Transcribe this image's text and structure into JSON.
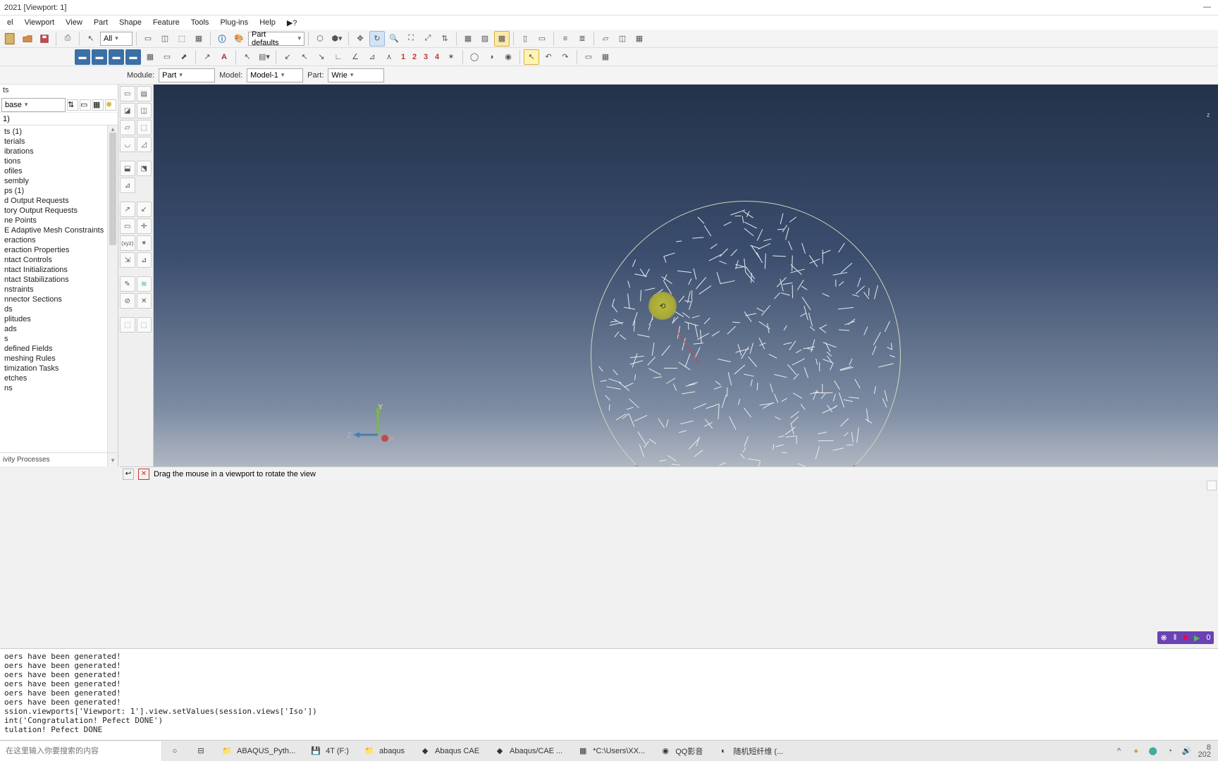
{
  "window": {
    "title": "2021  [Viewport: 1]",
    "min": "—",
    "restore": "",
    "close": ""
  },
  "menu": [
    "el",
    "Viewport",
    "View",
    "Part",
    "Shape",
    "Feature",
    "Tools",
    "Plug-ins",
    "Help",
    "▶?"
  ],
  "toolbar1": {
    "visibility_combo": "All",
    "part_defaults": "Part defaults"
  },
  "numbers": [
    "1",
    "2",
    "3",
    "4"
  ],
  "context": {
    "module_label": "Module:",
    "module_value": "Part",
    "model_label": "Model:",
    "model_value": "Model-1",
    "part_label": "Part:",
    "part_value": "Wrie"
  },
  "leftpanel": {
    "tab": "ts",
    "filter": "base",
    "root": "1)",
    "items": [
      "ts (1)",
      "terials",
      "ibrations",
      "tions",
      "ofiles",
      "sembly",
      "ps (1)",
      "d Output Requests",
      "tory Output Requests",
      "ne Points",
      "E Adaptive Mesh Constraints",
      "eractions",
      "eraction Properties",
      "ntact Controls",
      "ntact Initializations",
      "ntact Stabilizations",
      "nstraints",
      "nnector Sections",
      "ds",
      "plitudes",
      "ads",
      "s",
      "defined Fields",
      "meshing Rules",
      "timization Tasks",
      "etches",
      "ns"
    ],
    "footer": "ivity Processes"
  },
  "viewport": {
    "triad_y": "Y",
    "triad_z": "Z",
    "triad_x": "X",
    "cube_z": "z",
    "rotate_glyph": "⟲"
  },
  "prompt": {
    "back": "↩",
    "cancel": "✕",
    "text": "Drag the mouse in a viewport to rotate the view"
  },
  "messages": "oers have been generated!\noers have been generated!\noers have been generated!\noers have been generated!\noers have been generated!\noers have been generated!\nssion.viewports['Viewport: 1'].view.setValues(session.views['Iso'])\nint('Congratulation! Pefect DONE')\ntulation! Pefect DONE",
  "recorder": {
    "a": "❋",
    "b": "‖",
    "c": "■",
    "d": "▶",
    "e": "0"
  },
  "taskbar": {
    "search_placeholder": "在这里输入你要搜索的内容",
    "items": [
      {
        "icon": "○",
        "label": ""
      },
      {
        "icon": "⊟",
        "label": ""
      },
      {
        "icon": "📁",
        "label": "ABAQUS_Pyth..."
      },
      {
        "icon": "💾",
        "label": "4T (F:)"
      },
      {
        "icon": "📁",
        "label": "abaqus"
      },
      {
        "icon": "◆",
        "label": "Abaqus CAE"
      },
      {
        "icon": "◆",
        "label": "Abaqus/CAE ..."
      },
      {
        "icon": "▦",
        "label": "*C:\\Users\\XX..."
      },
      {
        "icon": "◉",
        "label": "QQ影音"
      },
      {
        "icon": "◐",
        "label": "随机短纤维 (..."
      }
    ],
    "tray": [
      "^",
      "●",
      "⬤",
      "◔",
      "🔊",
      "8",
      "202"
    ]
  },
  "right_date_top": "8",
  "right_date_bot": "202"
}
